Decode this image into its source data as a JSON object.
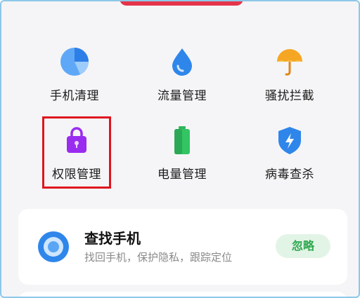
{
  "tools": [
    {
      "label": "手机清理",
      "icon": "phone-clean-icon"
    },
    {
      "label": "流量管理",
      "icon": "data-drop-icon"
    },
    {
      "label": "骚扰拦截",
      "icon": "umbrella-icon"
    },
    {
      "label": "权限管理",
      "icon": "lock-bag-icon"
    },
    {
      "label": "电量管理",
      "icon": "battery-icon"
    },
    {
      "label": "病毒查杀",
      "icon": "shield-lightning-icon"
    }
  ],
  "card": {
    "title": "查找手机",
    "subtitle": "找回手机，保护隐私，跟踪定位",
    "button_label": "忽略",
    "icon": "locate-icon"
  },
  "colors": {
    "highlight": "#e0141e",
    "accent_blue": "#2f86ea",
    "accent_green": "#2fa84f",
    "accent_purple": "#9a2cf0",
    "accent_orange": "#f5a623"
  }
}
